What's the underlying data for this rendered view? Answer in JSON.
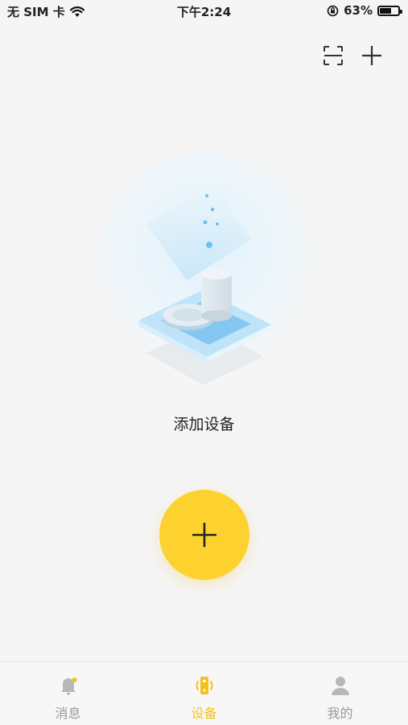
{
  "status_bar": {
    "carrier": "无 SIM 卡",
    "time": "下午2:24",
    "battery_percent": "63%",
    "battery_level": 0.63
  },
  "top_actions": {
    "scan_icon": "scan-icon",
    "add_icon": "plus-icon"
  },
  "main": {
    "title": "添加设备",
    "fab_icon": "plus-icon"
  },
  "tabs": [
    {
      "label": "消息",
      "icon": "bell-icon",
      "active": false
    },
    {
      "label": "设备",
      "icon": "device-icon",
      "active": true
    },
    {
      "label": "我的",
      "icon": "user-icon",
      "active": false
    }
  ],
  "colors": {
    "accent": "#fdd22f",
    "active_tab": "#f5c01b",
    "inactive_tab": "#999999",
    "illustration_blue": "#7cc3f0"
  }
}
